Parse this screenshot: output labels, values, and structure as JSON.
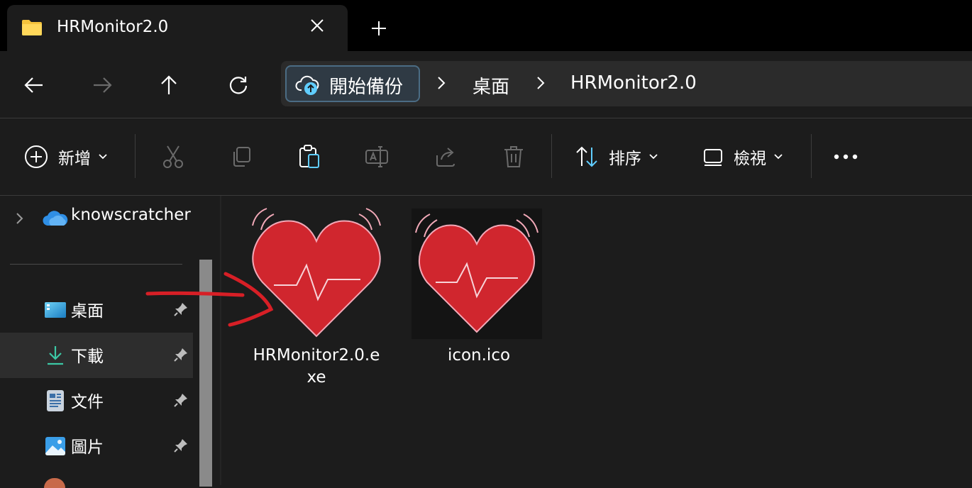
{
  "tab": {
    "title": "HRMonitor2.0",
    "close_icon": "close-icon",
    "add_icon": "plus-icon"
  },
  "nav": {
    "back_icon": "arrow-left-icon",
    "forward_icon": "arrow-right-icon",
    "up_icon": "arrow-up-icon",
    "refresh_icon": "refresh-icon"
  },
  "address": {
    "backup_label": "開始備份",
    "crumbs": [
      "桌面",
      "HRMonitor2.0"
    ]
  },
  "toolbar": {
    "new_label": "新增",
    "sort_label": "排序",
    "view_label": "檢視",
    "more_icon": "more-icon"
  },
  "sidebar": {
    "onedrive": {
      "label": "knowscratcher"
    },
    "items": [
      {
        "label": "桌面",
        "icon": "desktop-icon"
      },
      {
        "label": "下載",
        "icon": "download-icon"
      },
      {
        "label": "文件",
        "icon": "document-icon"
      },
      {
        "label": "圖片",
        "icon": "pictures-icon"
      }
    ]
  },
  "files": [
    {
      "name_line1": "HRMonitor2.0.e",
      "name_line2": "xe",
      "icon": "heart-monitor-icon"
    },
    {
      "name_line1": "icon.ico",
      "name_line2": "",
      "icon": "heart-monitor-icon"
    }
  ],
  "colors": {
    "accent": "#60cdff",
    "heart": "#d0262e",
    "annotation": "#d71f26"
  }
}
